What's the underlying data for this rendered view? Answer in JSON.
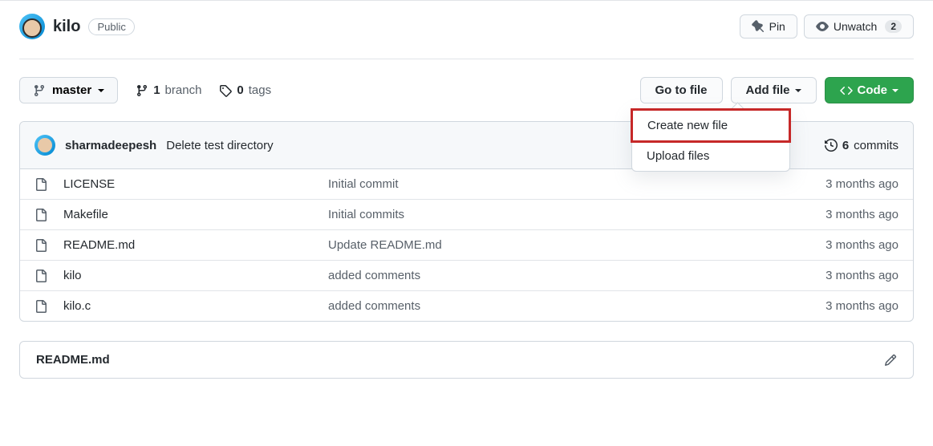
{
  "repo": {
    "name": "kilo",
    "visibility": "Public"
  },
  "header_actions": {
    "pin": "Pin",
    "unwatch": "Unwatch",
    "unwatch_count": "2"
  },
  "toolbar": {
    "branch": "master",
    "branch_count": "1",
    "branch_label": "branch",
    "tag_count": "0",
    "tag_label": "tags",
    "go_to_file": "Go to file",
    "add_file": "Add file",
    "code": "Code"
  },
  "add_file_menu": {
    "create": "Create new file",
    "upload": "Upload files"
  },
  "commit": {
    "author": "sharmadeepesh",
    "message": "Delete test directory",
    "count": "6",
    "count_label": "commits"
  },
  "files": [
    {
      "name": "LICENSE",
      "msg": "Initial commit",
      "time": "3 months ago"
    },
    {
      "name": "Makefile",
      "msg": "Initial commits",
      "time": "3 months ago"
    },
    {
      "name": "README.md",
      "msg": "Update README.md",
      "time": "3 months ago"
    },
    {
      "name": "kilo",
      "msg": "added comments",
      "time": "3 months ago"
    },
    {
      "name": "kilo.c",
      "msg": "added comments",
      "time": "3 months ago"
    }
  ],
  "readme": {
    "filename": "README.md"
  }
}
